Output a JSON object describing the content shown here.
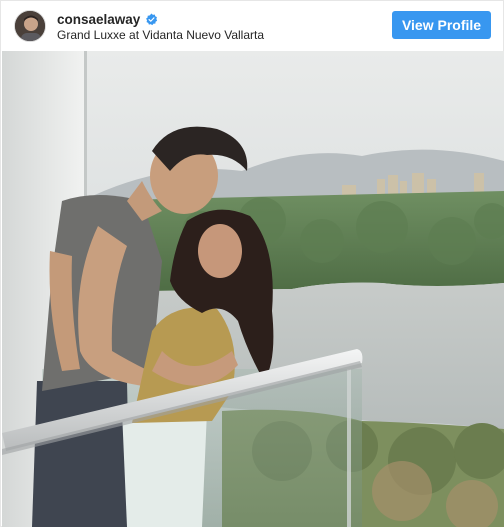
{
  "post": {
    "username": "consaelaway",
    "location": "Grand Luxxe at Vidanta Nuevo Vallarta",
    "view_profile_label": "View Profile",
    "verified": true
  },
  "colors": {
    "accent": "#3897f0",
    "verified_badge": "#3897f0",
    "text": "#262626"
  },
  "icons": {
    "verified": "verified-badge-icon"
  }
}
